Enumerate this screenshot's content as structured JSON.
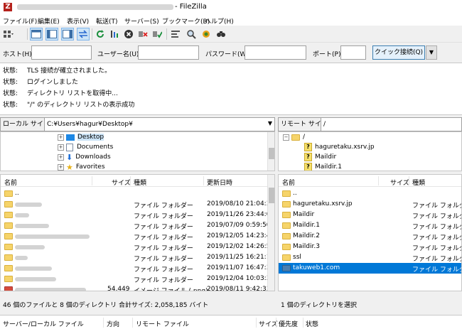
{
  "window": {
    "title": "- FileZilla"
  },
  "menu": [
    "ファイル(F)",
    "編集(E)",
    "表示(V)",
    "転送(T)",
    "サーバー(S)",
    "ブックマーク(B)",
    "ヘルプ(H)"
  ],
  "quickconnect": {
    "host_label": "ホスト(H):",
    "user_label": "ユーザー名(U):",
    "pass_label": "パスワード(W):",
    "port_label": "ポート(P):",
    "button": "クイック接続(Q)",
    "host_value": "",
    "user_value": "",
    "pass_value": "",
    "port_value": ""
  },
  "log": [
    {
      "k": "状態:",
      "v": "TLS 接続が確立されました。"
    },
    {
      "k": "状態:",
      "v": "ログインしました"
    },
    {
      "k": "状態:",
      "v": "ディレクトリ リストを取得中..."
    },
    {
      "k": "状態:",
      "v": "\"/\" のディレクトリ リストの表示成功"
    }
  ],
  "local": {
    "site_label": "ローカル サイト:",
    "path": "C:¥Users¥hagur¥Desktop¥",
    "tree": [
      "Desktop",
      "Documents",
      "Downloads",
      "Favorites"
    ],
    "columns": [
      "名前",
      "サイズ",
      "種類",
      "更新日時"
    ],
    "rows": [
      {
        "name": "..",
        "size": "",
        "type": "",
        "date": ""
      },
      {
        "name": "",
        "size": "",
        "type": "ファイル フォルダー",
        "date": "2019/08/10 21:04:38"
      },
      {
        "name": "",
        "size": "",
        "type": "ファイル フォルダー",
        "date": "2019/11/26 23:44:05"
      },
      {
        "name": "",
        "size": "",
        "type": "ファイル フォルダー",
        "date": "2019/07/09 0:59:50"
      },
      {
        "name": "",
        "size": "",
        "type": "ファイル フォルダー",
        "date": "2019/12/05 14:23:46"
      },
      {
        "name": "",
        "size": "",
        "type": "ファイル フォルダー",
        "date": "2019/12/02 14:26:50"
      },
      {
        "name": "",
        "size": "",
        "type": "ファイル フォルダー",
        "date": "2019/11/25 16:21:13"
      },
      {
        "name": "",
        "size": "",
        "type": "ファイル フォルダー",
        "date": "2019/11/07 16:47:37"
      },
      {
        "name": "",
        "size": "",
        "type": "ファイル フォルダー",
        "date": "2019/12/04 10:03:37"
      },
      {
        "name": "",
        "size": "54,449",
        "type": "イメージ ファイル (.png)",
        "date": "2019/08/11 9:42:33"
      }
    ],
    "status": "46 個のファイルと 8 個のディレクトリ 合計サイズ: 2,058,185 バイト"
  },
  "remote": {
    "site_label": "リモート サイト:",
    "path": "/",
    "tree_root": "/",
    "tree": [
      "haguretaku.xsrv.jp",
      "Maildir",
      "Maildir.1"
    ],
    "columns": [
      "名前",
      "サイズ",
      "種類"
    ],
    "rows": [
      {
        "name": "..",
        "type": ""
      },
      {
        "name": "haguretaku.xsrv.jp",
        "type": "ファイル フォルダー"
      },
      {
        "name": "Maildir",
        "type": "ファイル フォルダー"
      },
      {
        "name": "Maildir.1",
        "type": "ファイル フォルダー"
      },
      {
        "name": "Maildir.2",
        "type": "ファイル フォルダー"
      },
      {
        "name": "Maildir.3",
        "type": "ファイル フォルダー"
      },
      {
        "name": "ssl",
        "type": "ファイル フォルダー"
      },
      {
        "name": "takuweb1.com",
        "type": "ファイル フォルダー"
      }
    ],
    "status": "1 個のディレクトリを選択"
  },
  "queue": {
    "columns": [
      "サーバー/ローカル ファイル",
      "方向",
      "リモート ファイル",
      "サイズ",
      "優先度",
      "状態"
    ]
  },
  "colors": {
    "selection": "#0078d7",
    "folder": "#f6d46a"
  }
}
